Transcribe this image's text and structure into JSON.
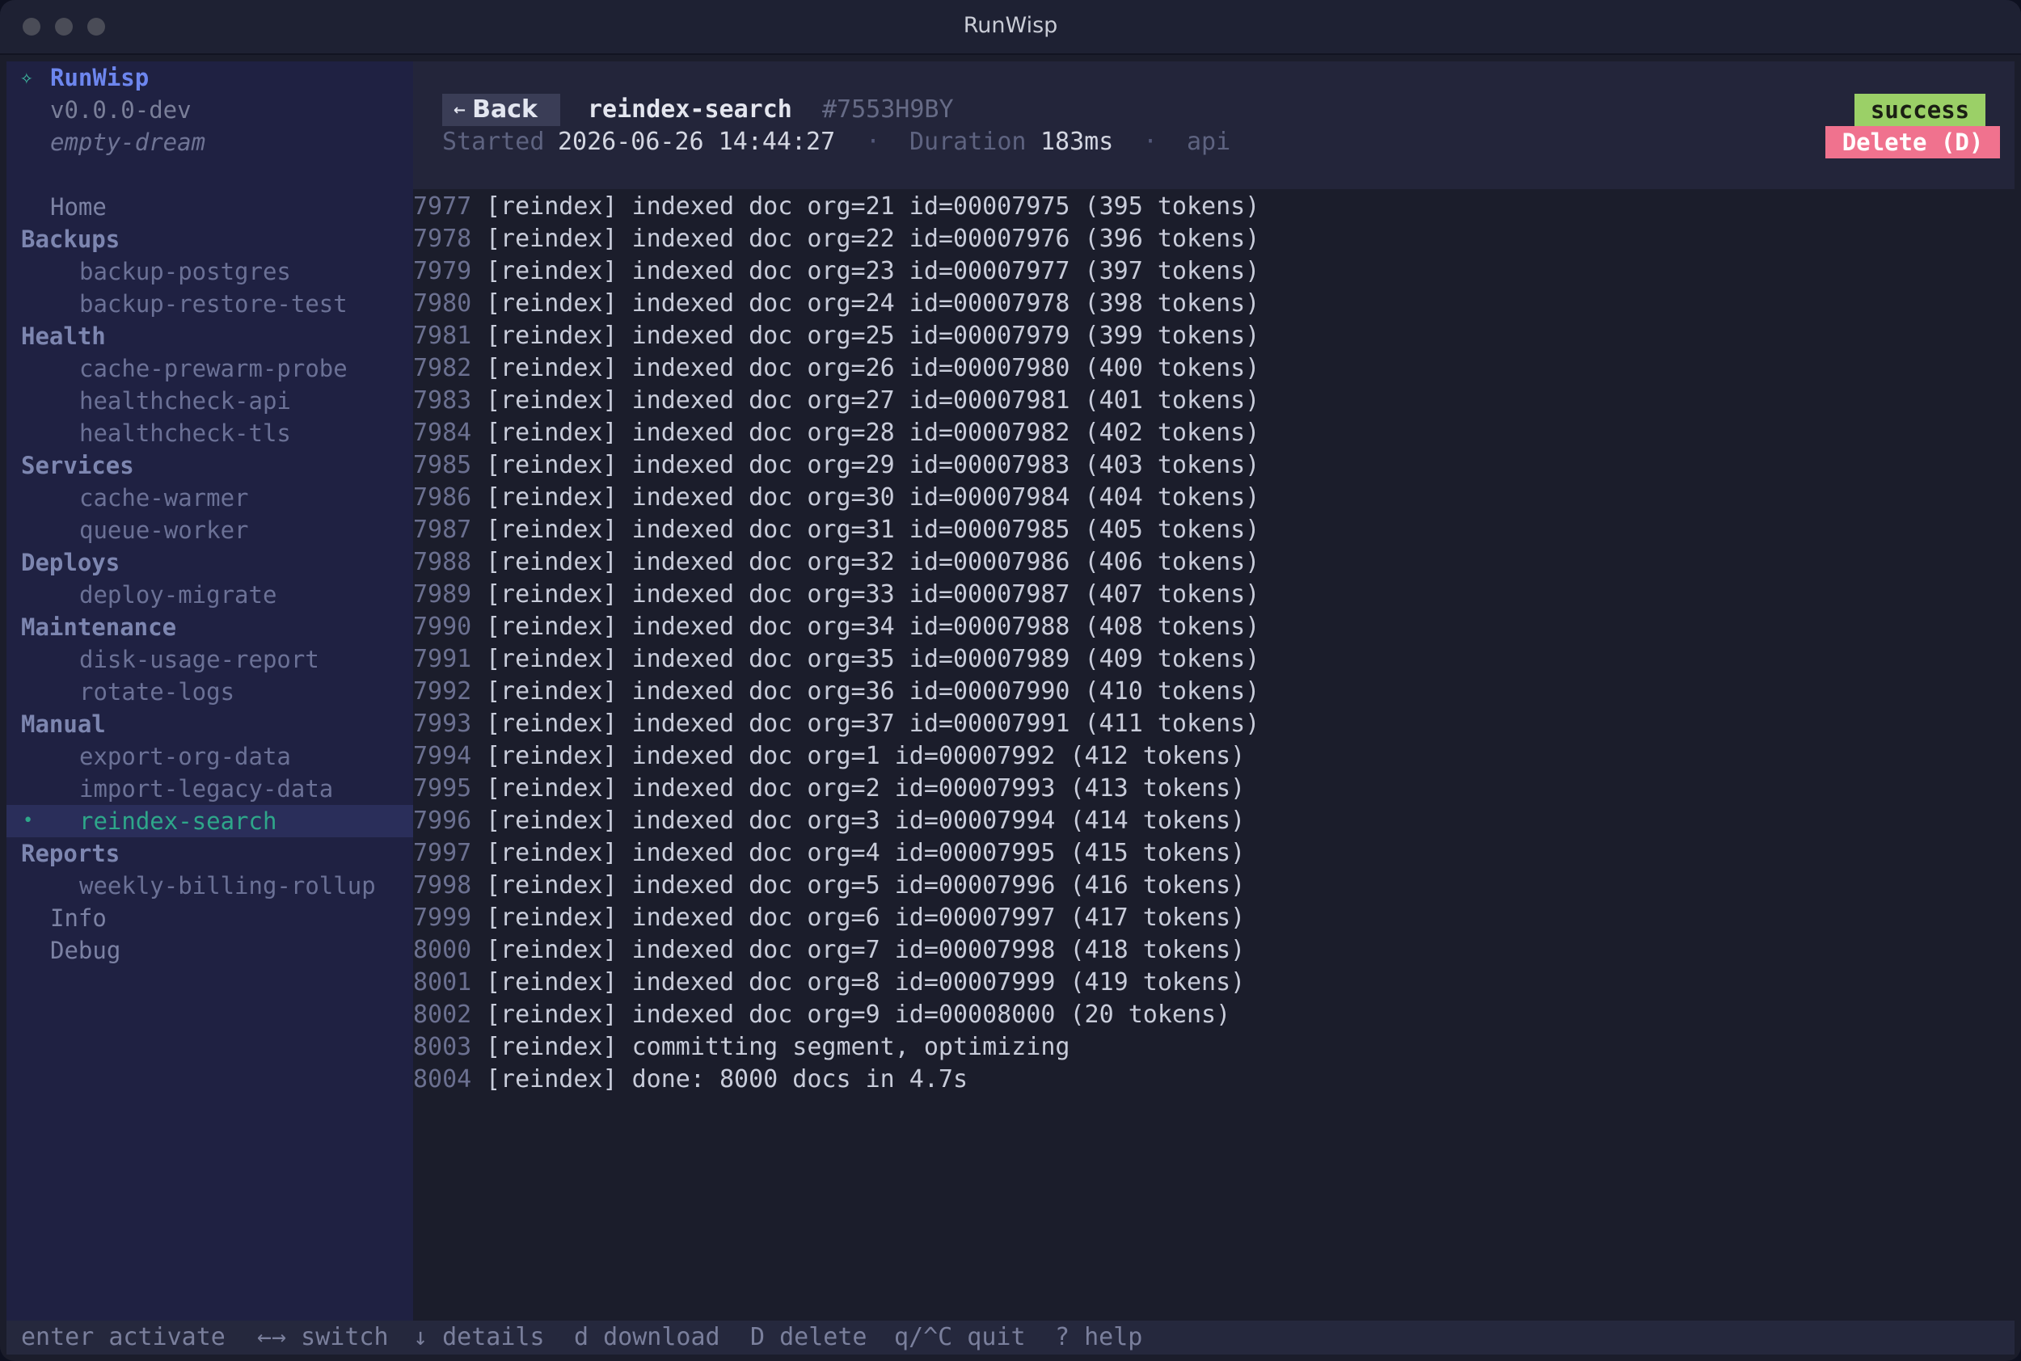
{
  "window": {
    "title": "RunWisp"
  },
  "sidebar": {
    "brand_mark": "✧",
    "brand": "RunWisp",
    "version": "v0.0.0-dev",
    "host": "empty-dream",
    "top_items": [
      "Home"
    ],
    "groups": [
      {
        "name": "Backups",
        "jobs": [
          "backup-postgres",
          "backup-restore-test"
        ]
      },
      {
        "name": "Health",
        "jobs": [
          "cache-prewarm-probe",
          "healthcheck-api",
          "healthcheck-tls"
        ]
      },
      {
        "name": "Services",
        "jobs": [
          "cache-warmer",
          "queue-worker"
        ]
      },
      {
        "name": "Deploys",
        "jobs": [
          "deploy-migrate"
        ]
      },
      {
        "name": "Maintenance",
        "jobs": [
          "disk-usage-report",
          "rotate-logs"
        ]
      },
      {
        "name": "Manual",
        "jobs": [
          "export-org-data",
          "import-legacy-data",
          "reindex-search"
        ]
      },
      {
        "name": "Reports",
        "jobs": [
          "weekly-billing-rollup"
        ]
      }
    ],
    "active_job": "reindex-search",
    "active_marker": "•",
    "bottom_items": [
      "Info",
      "Debug"
    ]
  },
  "header": {
    "back_arrow": "←",
    "back_label": "Back",
    "job_name": "reindex-search",
    "run_id": "#7553H9BY",
    "started_label": "Started",
    "started_value": "2026-06-26 14:44:27",
    "separator": "·",
    "duration_label": "Duration",
    "duration_value": "183ms",
    "source": "api",
    "status": "success",
    "delete_label": "Delete (D)"
  },
  "log": [
    {
      "n": "7977",
      "text": "[reindex] indexed doc org=21 id=00007975 (395 tokens)"
    },
    {
      "n": "7978",
      "text": "[reindex] indexed doc org=22 id=00007976 (396 tokens)"
    },
    {
      "n": "7979",
      "text": "[reindex] indexed doc org=23 id=00007977 (397 tokens)"
    },
    {
      "n": "7980",
      "text": "[reindex] indexed doc org=24 id=00007978 (398 tokens)"
    },
    {
      "n": "7981",
      "text": "[reindex] indexed doc org=25 id=00007979 (399 tokens)"
    },
    {
      "n": "7982",
      "text": "[reindex] indexed doc org=26 id=00007980 (400 tokens)"
    },
    {
      "n": "7983",
      "text": "[reindex] indexed doc org=27 id=00007981 (401 tokens)"
    },
    {
      "n": "7984",
      "text": "[reindex] indexed doc org=28 id=00007982 (402 tokens)"
    },
    {
      "n": "7985",
      "text": "[reindex] indexed doc org=29 id=00007983 (403 tokens)"
    },
    {
      "n": "7986",
      "text": "[reindex] indexed doc org=30 id=00007984 (404 tokens)"
    },
    {
      "n": "7987",
      "text": "[reindex] indexed doc org=31 id=00007985 (405 tokens)"
    },
    {
      "n": "7988",
      "text": "[reindex] indexed doc org=32 id=00007986 (406 tokens)"
    },
    {
      "n": "7989",
      "text": "[reindex] indexed doc org=33 id=00007987 (407 tokens)"
    },
    {
      "n": "7990",
      "text": "[reindex] indexed doc org=34 id=00007988 (408 tokens)"
    },
    {
      "n": "7991",
      "text": "[reindex] indexed doc org=35 id=00007989 (409 tokens)"
    },
    {
      "n": "7992",
      "text": "[reindex] indexed doc org=36 id=00007990 (410 tokens)"
    },
    {
      "n": "7993",
      "text": "[reindex] indexed doc org=37 id=00007991 (411 tokens)"
    },
    {
      "n": "7994",
      "text": "[reindex] indexed doc org=1 id=00007992 (412 tokens)"
    },
    {
      "n": "7995",
      "text": "[reindex] indexed doc org=2 id=00007993 (413 tokens)"
    },
    {
      "n": "7996",
      "text": "[reindex] indexed doc org=3 id=00007994 (414 tokens)"
    },
    {
      "n": "7997",
      "text": "[reindex] indexed doc org=4 id=00007995 (415 tokens)"
    },
    {
      "n": "7998",
      "text": "[reindex] indexed doc org=5 id=00007996 (416 tokens)"
    },
    {
      "n": "7999",
      "text": "[reindex] indexed doc org=6 id=00007997 (417 tokens)"
    },
    {
      "n": "8000",
      "text": "[reindex] indexed doc org=7 id=00007998 (418 tokens)"
    },
    {
      "n": "8001",
      "text": "[reindex] indexed doc org=8 id=00007999 (419 tokens)"
    },
    {
      "n": "8002",
      "text": "[reindex] indexed doc org=9 id=00008000 (20 tokens)"
    },
    {
      "n": "8003",
      "text": "[reindex] committing segment, optimizing"
    },
    {
      "n": "8004",
      "text": "[reindex] done: 8000 docs in 4.7s"
    }
  ],
  "footer": {
    "hints": [
      "enter activate",
      "←→ switch",
      "↓ details",
      "d download",
      "D delete",
      "q/^C quit",
      "? help"
    ]
  }
}
